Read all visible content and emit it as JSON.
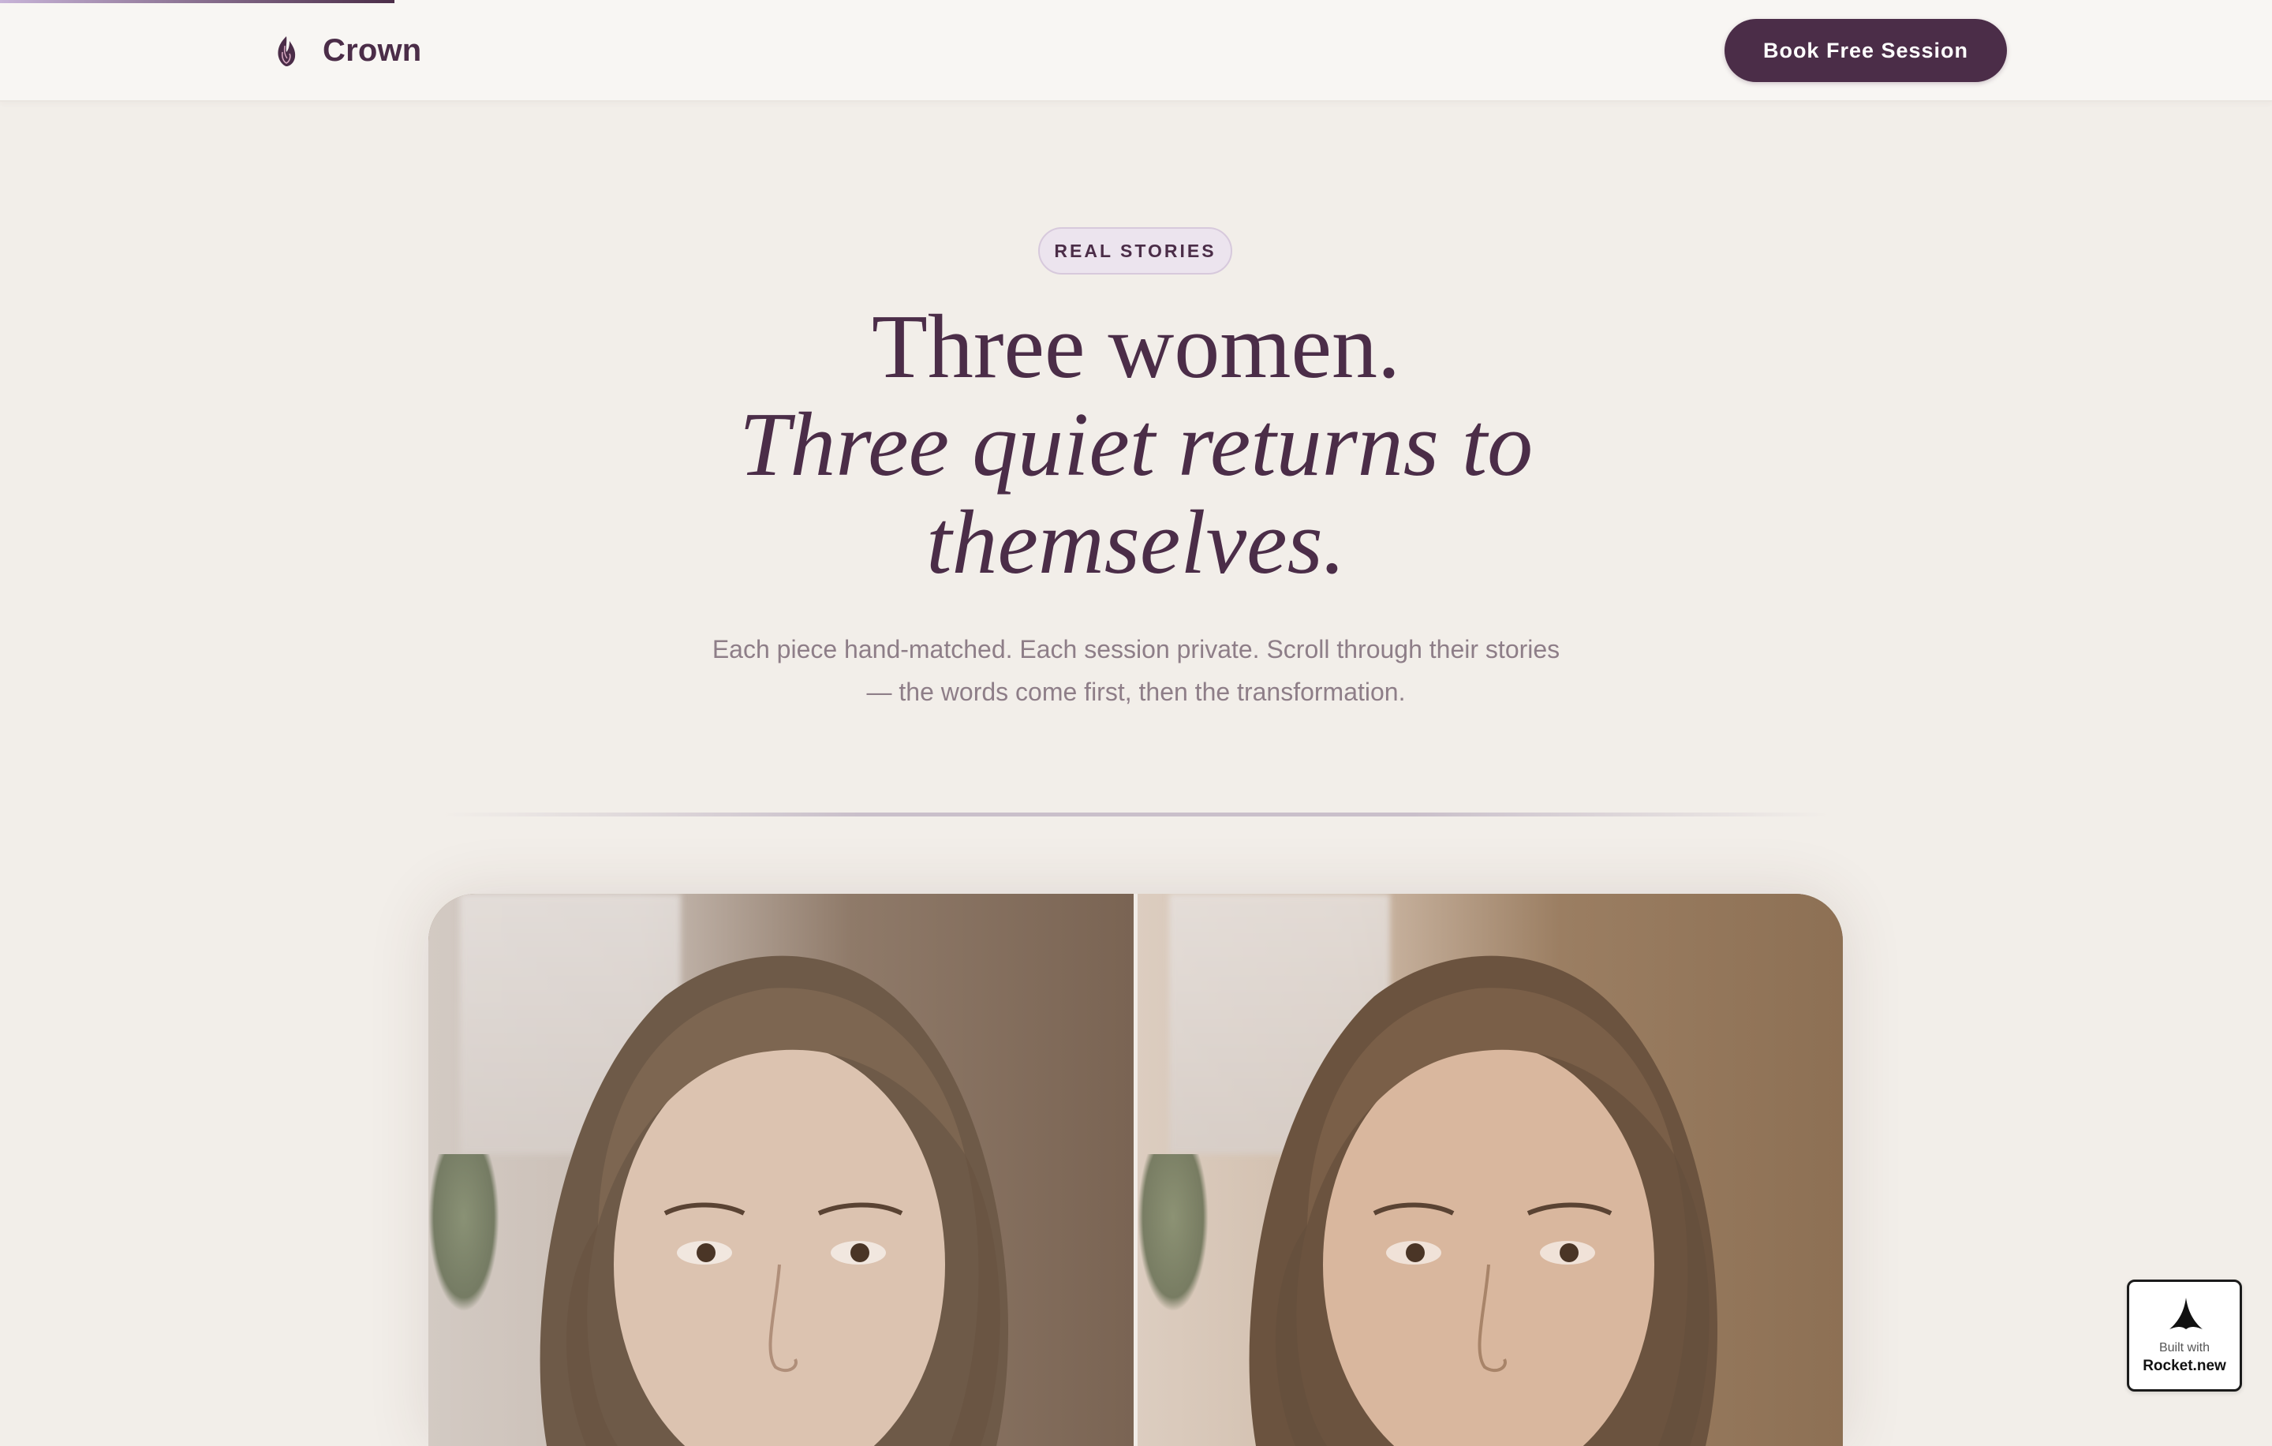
{
  "nav": {
    "brand_name": "Crown",
    "brand_icon": "crown-flame-icon",
    "cta_label": "Book Free Session"
  },
  "hero": {
    "eyebrow": "REAL STORIES",
    "title_line1": "Three women.",
    "title_line2": "Three quiet returns to",
    "title_line3": "themselves.",
    "subtitle_line1": "Each piece hand-matched. Each session private. Scroll through their stories",
    "subtitle_line2": "— the words come first, then the transformation."
  },
  "story": {
    "before_image": "woman-portrait-before",
    "after_image": "woman-portrait-after"
  },
  "badge": {
    "built_with": "Built with",
    "name": "Rocket.new"
  },
  "colors": {
    "brand": "#4b2d48",
    "background": "#f2eee9",
    "pill_bg": "#ece4ee",
    "muted_text": "#8e7e88"
  }
}
